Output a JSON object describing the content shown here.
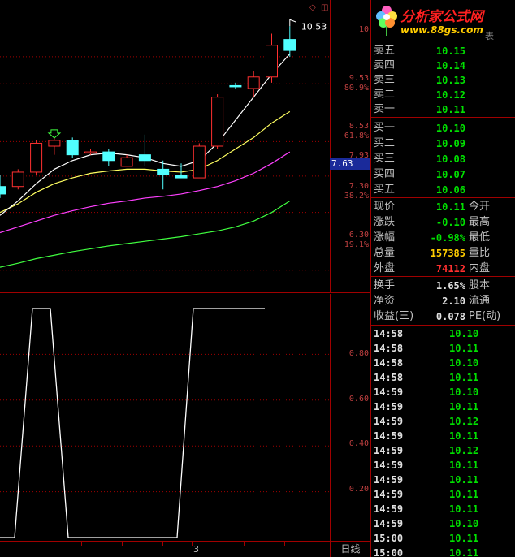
{
  "colors": {
    "up": "#ff3030",
    "down": "#50ffff",
    "ma1": "#ffffff",
    "ma2": "#ffff60",
    "ma3": "#ff40ff",
    "ma4": "#40ff40",
    "grid": "#a00000",
    "indicator": "#ffffff"
  },
  "window_buttons": {
    "diamond": "◇",
    "square": "◫"
  },
  "logo": {
    "name": "分析家公式网",
    "url": "www.88gs.com",
    "overlay": "表"
  },
  "price_axis": [
    {
      "value": "10",
      "pct": ""
    },
    {
      "value": "9.53",
      "pct": "80.9%"
    },
    {
      "value": "8.53",
      "pct": "61.8%"
    },
    {
      "value": "7.93",
      "pct": ""
    },
    {
      "value": "7.30",
      "pct": "38.2%"
    },
    {
      "value": "6.30",
      "pct": "19.1%"
    }
  ],
  "current_price_tag": "7.63",
  "high_marker": "10.53",
  "sub_axis": [
    "0.80",
    "0.60",
    "0.40",
    "0.20"
  ],
  "date_label": "3",
  "period_label": "日线",
  "sell_orders": [
    {
      "label": "卖五",
      "price": "10.15"
    },
    {
      "label": "卖四",
      "price": "10.14"
    },
    {
      "label": "卖三",
      "price": "10.13"
    },
    {
      "label": "卖二",
      "price": "10.12"
    },
    {
      "label": "卖一",
      "price": "10.11"
    }
  ],
  "buy_orders": [
    {
      "label": "买一",
      "price": "10.10"
    },
    {
      "label": "买二",
      "price": "10.09"
    },
    {
      "label": "买三",
      "price": "10.08"
    },
    {
      "label": "买四",
      "price": "10.07"
    },
    {
      "label": "买五",
      "price": "10.06"
    }
  ],
  "stats": [
    {
      "label": "现价",
      "value": "10.11",
      "label2": "今开",
      "color": "#00e000"
    },
    {
      "label": "涨跌",
      "value": "-0.10",
      "label2": "最高",
      "color": "#00e000"
    },
    {
      "label": "涨幅",
      "value": "-0.98%",
      "label2": "最低",
      "color": "#00e000"
    },
    {
      "label": "总量",
      "value": "157385",
      "label2": "量比",
      "color": "#ffcc00"
    },
    {
      "label": "外盘",
      "value": "74112",
      "label2": "内盘",
      "color": "#ff3030"
    }
  ],
  "stats2": [
    {
      "label": "换手",
      "value": "1.65%",
      "label2": "股本",
      "color": "#e0e0e0"
    },
    {
      "label": "净资",
      "value": "2.10",
      "label2": "流通",
      "color": "#e0e0e0"
    },
    {
      "label": "收益(三)",
      "value": "0.078",
      "label2": "PE(动)",
      "color": "#e0e0e0"
    }
  ],
  "ticks": [
    {
      "time": "14:58",
      "price": "10.10"
    },
    {
      "time": "14:58",
      "price": "10.11"
    },
    {
      "time": "14:58",
      "price": "10.10"
    },
    {
      "time": "14:58",
      "price": "10.11"
    },
    {
      "time": "14:59",
      "price": "10.10"
    },
    {
      "time": "14:59",
      "price": "10.11"
    },
    {
      "time": "14:59",
      "price": "10.12"
    },
    {
      "time": "14:59",
      "price": "10.11"
    },
    {
      "time": "14:59",
      "price": "10.12"
    },
    {
      "time": "14:59",
      "price": "10.11"
    },
    {
      "time": "14:59",
      "price": "10.11"
    },
    {
      "time": "14:59",
      "price": "10.11"
    },
    {
      "time": "14:59",
      "price": "10.11"
    },
    {
      "time": "14:59",
      "price": "10.10"
    },
    {
      "time": "15:00",
      "price": "10.11"
    },
    {
      "time": "15:00",
      "price": "10.11"
    }
  ],
  "chart_data": {
    "type": "candlestick",
    "ylim": [
      6.0,
      10.9
    ],
    "candles": [
      {
        "o": 7.75,
        "h": 7.95,
        "l": 7.55,
        "c": 7.62
      },
      {
        "o": 7.75,
        "h": 8.05,
        "l": 7.7,
        "c": 8.0
      },
      {
        "o": 8.0,
        "h": 8.55,
        "l": 7.95,
        "c": 8.5
      },
      {
        "o": 8.45,
        "h": 8.6,
        "l": 8.3,
        "c": 8.55
      },
      {
        "o": 8.55,
        "h": 8.6,
        "l": 8.25,
        "c": 8.3
      },
      {
        "o": 8.35,
        "h": 8.4,
        "l": 8.3,
        "c": 8.35
      },
      {
        "o": 8.35,
        "h": 8.4,
        "l": 8.1,
        "c": 8.2
      },
      {
        "o": 8.1,
        "h": 8.3,
        "l": 8.1,
        "c": 8.25
      },
      {
        "o": 8.3,
        "h": 8.65,
        "l": 8.1,
        "c": 8.2
      },
      {
        "o": 8.05,
        "h": 8.2,
        "l": 7.7,
        "c": 7.95
      },
      {
        "o": 7.95,
        "h": 8.15,
        "l": 7.9,
        "c": 7.9
      },
      {
        "o": 7.9,
        "h": 8.5,
        "l": 7.9,
        "c": 8.45
      },
      {
        "o": 8.45,
        "h": 9.35,
        "l": 8.4,
        "c": 9.3
      },
      {
        "o": 9.5,
        "h": 9.55,
        "l": 9.45,
        "c": 9.48
      },
      {
        "o": 9.45,
        "h": 9.75,
        "l": 9.3,
        "c": 9.65
      },
      {
        "o": 9.65,
        "h": 10.4,
        "l": 9.55,
        "c": 10.2
      },
      {
        "o": 10.3,
        "h": 10.53,
        "l": 10.0,
        "c": 10.11
      }
    ],
    "ma_white": [
      7.25,
      7.5,
      7.8,
      8.05,
      8.2,
      8.3,
      8.33,
      8.3,
      8.25,
      8.15,
      8.1,
      8.2,
      8.5,
      8.9,
      9.3,
      9.7,
      10.05
    ],
    "ma_yellow": [
      7.3,
      7.45,
      7.65,
      7.8,
      7.9,
      7.98,
      8.02,
      8.05,
      8.05,
      8.02,
      8.0,
      8.05,
      8.2,
      8.4,
      8.6,
      8.85,
      9.05
    ],
    "ma_magenta": [
      6.95,
      7.05,
      7.15,
      7.25,
      7.33,
      7.4,
      7.46,
      7.5,
      7.55,
      7.58,
      7.62,
      7.68,
      7.75,
      7.85,
      7.98,
      8.15,
      8.35
    ],
    "ma_green": [
      6.35,
      6.42,
      6.5,
      6.56,
      6.62,
      6.67,
      6.72,
      6.76,
      6.8,
      6.84,
      6.88,
      6.93,
      6.98,
      7.05,
      7.15,
      7.3,
      7.5
    ],
    "indicator": [
      0,
      0,
      1,
      1,
      0,
      0,
      0,
      0,
      0,
      0,
      0,
      1,
      1,
      1,
      1,
      1,
      1
    ],
    "sub_ylim": [
      0,
      1.0
    ]
  }
}
